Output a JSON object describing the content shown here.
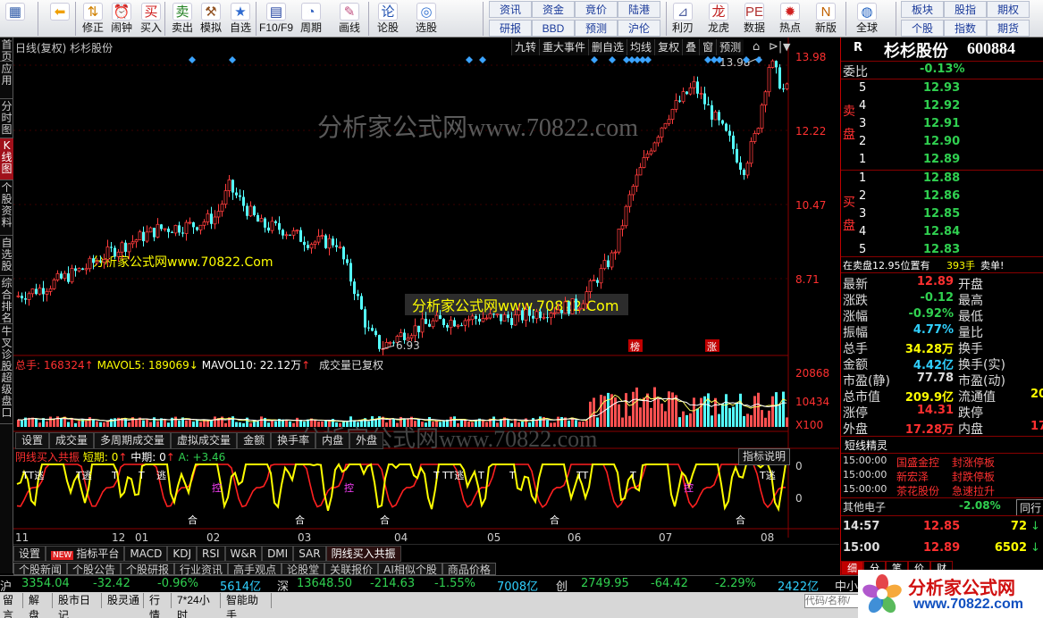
{
  "toolbar": {
    "buttons": [
      {
        "label": "",
        "icon": "grid-icon"
      },
      {
        "label": "",
        "icon": "back-arrow-icon"
      },
      {
        "label": "修正",
        "icon": "up-down-icon"
      },
      {
        "label": "闹钟",
        "icon": "alarm-clock-icon"
      },
      {
        "label": "买入",
        "icon": "buy-icon"
      },
      {
        "label": "卖出",
        "icon": "sell-icon"
      },
      {
        "label": "模拟",
        "icon": "gavel-icon"
      },
      {
        "label": "自选",
        "icon": "star-icon"
      },
      {
        "label": "F10/F9",
        "icon": "f10-icon"
      },
      {
        "label": "周期",
        "icon": "clock-icon"
      },
      {
        "label": "画线",
        "icon": "pen-icon"
      },
      {
        "label": "论股",
        "icon": "discuss-icon"
      },
      {
        "label": "选股",
        "icon": "select-stock-icon"
      },
      {
        "label": "利刃",
        "icon": "ruler-icon"
      },
      {
        "label": "龙虎",
        "icon": "dragon-icon"
      },
      {
        "label": "数据",
        "icon": "pe-icon"
      },
      {
        "label": "热点",
        "icon": "hot-icon"
      },
      {
        "label": "新版",
        "icon": "new-version-icon"
      },
      {
        "label": "全球",
        "icon": "globe-icon"
      }
    ],
    "mini_buttons": [
      "资讯",
      "资金",
      "竟价",
      "陆港",
      "研报",
      "BBD",
      "预测",
      "沪伦",
      "板块",
      "股指",
      "期权",
      "个股",
      "指数",
      "期货"
    ]
  },
  "chart": {
    "title": "日线(复权) 杉杉股份",
    "buttons": [
      "九转",
      "重大事件",
      "删自选",
      "均线",
      "复权",
      "叠",
      "窗",
      "预测"
    ],
    "price_labels": [
      "13.98",
      "12.22",
      "10.47",
      "8.71"
    ],
    "high_label": "13.98",
    "low_label": "6.93",
    "markers": [
      "榜",
      "涨"
    ],
    "watermarks": [
      "分析家公式网www.70822.com",
      "分析家公式网www.70822.Com",
      "分析家公式网www.70822.Com",
      "分析家公式网www.70822.com"
    ],
    "vol_info": {
      "label": "总手: 168324",
      "mavol5": "MAVOL5: 189069",
      "mavol10": "MAVOL10: 22.12万",
      "note": "成交量已复权"
    },
    "vol_labels": [
      "20868",
      "10434",
      "X100"
    ],
    "vol_tabs": [
      "设置",
      "成交量",
      "多周期成交量",
      "虚拟成交量",
      "金额",
      "换手率",
      "内盘",
      "外盘"
    ],
    "ind_info": {
      "name": "阴线买入共振",
      "s1": "短期: 0",
      "s2": "中期: 0",
      "s3": "A: +3.46"
    },
    "ind_explain": "指标说明",
    "ind_labels": [
      "0",
      "0"
    ],
    "ind_texts": [
      "TT逃",
      "T逃",
      "逃",
      "T",
      "T",
      "T",
      "控",
      "控",
      "控",
      "TT逃",
      "TT",
      "T逃",
      "T",
      "T",
      "T",
      "合",
      "合",
      "合",
      "合",
      "合"
    ],
    "x_labels": [
      "11",
      "12",
      "01",
      "02",
      "03",
      "04",
      "05",
      "06",
      "07",
      "08"
    ],
    "bottom_tabs": [
      "设置",
      "指标平台",
      "MACD",
      "KDJ",
      "RSI",
      "W&R",
      "DMI",
      "SAR",
      "阴线买入共振"
    ],
    "new_badge": "NEW",
    "news_tabs": [
      "个股新闻",
      "个股公告",
      "个股研报",
      "行业资讯",
      "高手观点",
      "论股堂",
      "关联报价",
      "AI相似个股",
      "商品价格"
    ]
  },
  "left_nav": [
    "首页",
    "应用",
    "分时图",
    "K线图",
    "个股资料",
    "自选股",
    "综合排名",
    "牛叉诊股",
    "超级盘口"
  ],
  "stock": {
    "r": "R",
    "name": "杉杉股份",
    "code": "600884"
  },
  "quote": {
    "weibi_label": "委比",
    "weibi": "-0.13%",
    "sell_label": "卖盘",
    "buy_label": "买盘",
    "sell": [
      {
        "n": "5",
        "p": "12.93"
      },
      {
        "n": "4",
        "p": "12.92"
      },
      {
        "n": "3",
        "p": "12.91"
      },
      {
        "n": "2",
        "p": "12.90"
      },
      {
        "n": "1",
        "p": "12.89"
      }
    ],
    "buy": [
      {
        "n": "1",
        "p": "12.88"
      },
      {
        "n": "2",
        "p": "12.86"
      },
      {
        "n": "3",
        "p": "12.85"
      },
      {
        "n": "4",
        "p": "12.84"
      },
      {
        "n": "5",
        "p": "12.83"
      }
    ],
    "notice": "在卖盘12.95位置有",
    "notice_qty": "393手",
    "notice_tag": "卖单!",
    "stats": [
      {
        "l": "最新",
        "v": "12.89",
        "c": "#ff3030",
        "r": "开盘"
      },
      {
        "l": "涨跌",
        "v": "-0.12",
        "c": "#30d050",
        "r": "最高"
      },
      {
        "l": "涨幅",
        "v": "-0.92%",
        "c": "#30d050",
        "r": "最低"
      },
      {
        "l": "振幅",
        "v": "4.77%",
        "c": "#30d0ff",
        "r": "量比"
      },
      {
        "l": "总手",
        "v": "34.28万",
        "c": "#ffff00",
        "r": "换手"
      },
      {
        "l": "金额",
        "v": "4.42亿",
        "c": "#30d0ff",
        "r": "换手(实)"
      },
      {
        "l": "市盈(静)",
        "v": "77.78",
        "c": "#dddddd",
        "r": "市盈(动)"
      },
      {
        "l": "总市值",
        "v": "209.9亿",
        "c": "#ffff00",
        "r": "流通值",
        "rv": "20"
      },
      {
        "l": "涨停",
        "v": "14.31",
        "c": "#ff3030",
        "r": "跌停"
      },
      {
        "l": "外盘",
        "v": "17.28万",
        "c": "#ff3030",
        "r": "内盘",
        "rv": "17"
      }
    ],
    "spirit_title": "短线精灵",
    "spirit": [
      {
        "t": "15:00:00",
        "s": "国盛金控",
        "e": "封涨停板"
      },
      {
        "t": "15:00:00",
        "s": "新宏泽",
        "e": "封跌停板"
      },
      {
        "t": "15:00:00",
        "s": "茶花股份",
        "e": "急速拉升"
      }
    ],
    "other_name": "其他电子",
    "other_pct": "-2.08%",
    "other_btn": "同行",
    "ticks": [
      {
        "t": "14:57",
        "p": "12.85",
        "q": "72"
      },
      {
        "t": "15:00",
        "p": "12.89",
        "q": "6502"
      }
    ],
    "detail_tabs": [
      "细",
      "分",
      "笔",
      "价",
      "财"
    ]
  },
  "index_bar": {
    "sh": {
      "n": "沪",
      "p": "3354.04",
      "c": "-32.42",
      "pct": "-0.96%",
      "a": "5614亿"
    },
    "sz": {
      "n": "深",
      "p": "13648.50",
      "c": "-214.63",
      "pct": "-1.55%",
      "a": "7008亿"
    },
    "cy": {
      "n": "创",
      "p": "2749.95",
      "c": "-64.42",
      "pct": "-2.29%",
      "a": "2422亿"
    },
    "zx": "中小"
  },
  "status": [
    "留言",
    "解盘",
    "股市日记",
    "股灵通",
    "行情",
    "7*24小时",
    "智能助手"
  ],
  "search_placeholder": "代码/名称/",
  "brand": {
    "name": "分析家公式网",
    "url": "www.70822.com"
  }
}
